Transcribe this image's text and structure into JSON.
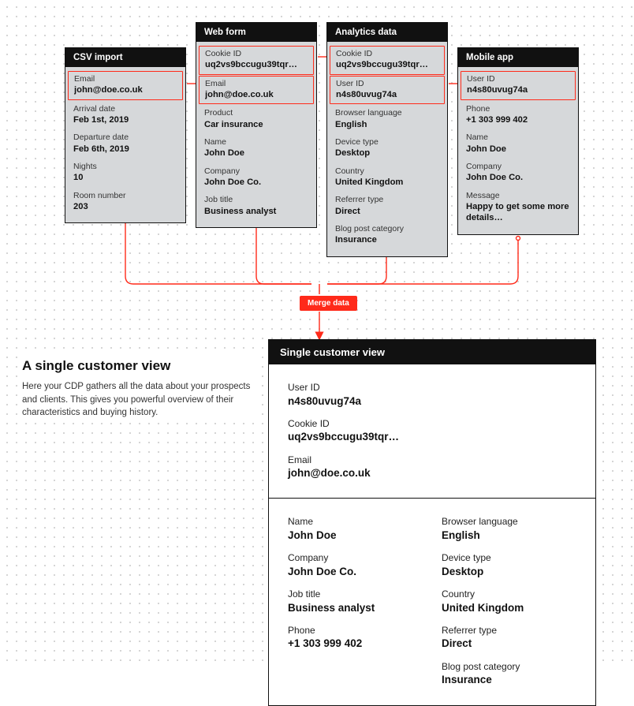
{
  "sources": {
    "csv": {
      "title": "CSV import",
      "fields": [
        {
          "label": "Email",
          "value": "john@doe.co.uk",
          "hi": true
        },
        {
          "label": "Arrival date",
          "value": "Feb 1st, 2019"
        },
        {
          "label": "Departure date",
          "value": "Feb 6th, 2019"
        },
        {
          "label": "Nights",
          "value": "10"
        },
        {
          "label": "Room number",
          "value": "203"
        }
      ]
    },
    "webform": {
      "title": "Web form",
      "fields": [
        {
          "label": "Cookie ID",
          "value": "uq2vs9bccugu39tqr…",
          "hi": true
        },
        {
          "label": "Email",
          "value": "john@doe.co.uk",
          "hi": true
        },
        {
          "label": "Product",
          "value": "Car insurance"
        },
        {
          "label": "Name",
          "value": "John Doe"
        },
        {
          "label": "Company",
          "value": "John Doe Co."
        },
        {
          "label": "Job title",
          "value": "Business analyst"
        }
      ]
    },
    "analytics": {
      "title": "Analytics data",
      "fields": [
        {
          "label": "Cookie ID",
          "value": "uq2vs9bccugu39tqr…",
          "hi": true
        },
        {
          "label": "User ID",
          "value": "n4s80uvug74a",
          "hi": true
        },
        {
          "label": "Browser language",
          "value": "English"
        },
        {
          "label": "Device type",
          "value": "Desktop"
        },
        {
          "label": "Country",
          "value": "United Kingdom"
        },
        {
          "label": "Referrer type",
          "value": "Direct"
        },
        {
          "label": "Blog post category",
          "value": "Insurance"
        }
      ]
    },
    "mobile": {
      "title": "Mobile app",
      "fields": [
        {
          "label": "User ID",
          "value": "n4s80uvug74a",
          "hi": true
        },
        {
          "label": "Phone",
          "value": "+1 303 999 402"
        },
        {
          "label": "Name",
          "value": "John Doe"
        },
        {
          "label": "Company",
          "value": "John Doe Co."
        },
        {
          "label": "Message",
          "value": "Happy to get some more details…",
          "wrap": true
        }
      ]
    }
  },
  "merge_label": "Merge data",
  "explain": {
    "heading": "A single customer view",
    "body": "Here your CDP gathers all the data about your prospects and clients. This gives you powerful overview of their characteristics and buying history."
  },
  "result": {
    "title": "Single customer view",
    "identity": [
      {
        "label": "User ID",
        "value": "n4s80uvug74a"
      },
      {
        "label": "Cookie ID",
        "value": "uq2vs9bccugu39tqr…"
      },
      {
        "label": "Email",
        "value": "john@doe.co.uk"
      }
    ],
    "left": [
      {
        "label": "Name",
        "value": "John Doe"
      },
      {
        "label": "Company",
        "value": "John Doe Co."
      },
      {
        "label": "Job title",
        "value": "Business analyst"
      },
      {
        "label": "Phone",
        "value": "+1 303 999 402"
      }
    ],
    "right": [
      {
        "label": "Browser language",
        "value": "English"
      },
      {
        "label": "Device type",
        "value": "Desktop"
      },
      {
        "label": "Country",
        "value": "United Kingdom"
      },
      {
        "label": "Referrer type",
        "value": "Direct"
      },
      {
        "label": "Blog post category",
        "value": "Insurance"
      }
    ]
  },
  "colors": {
    "accent": "#ff2a1a"
  }
}
